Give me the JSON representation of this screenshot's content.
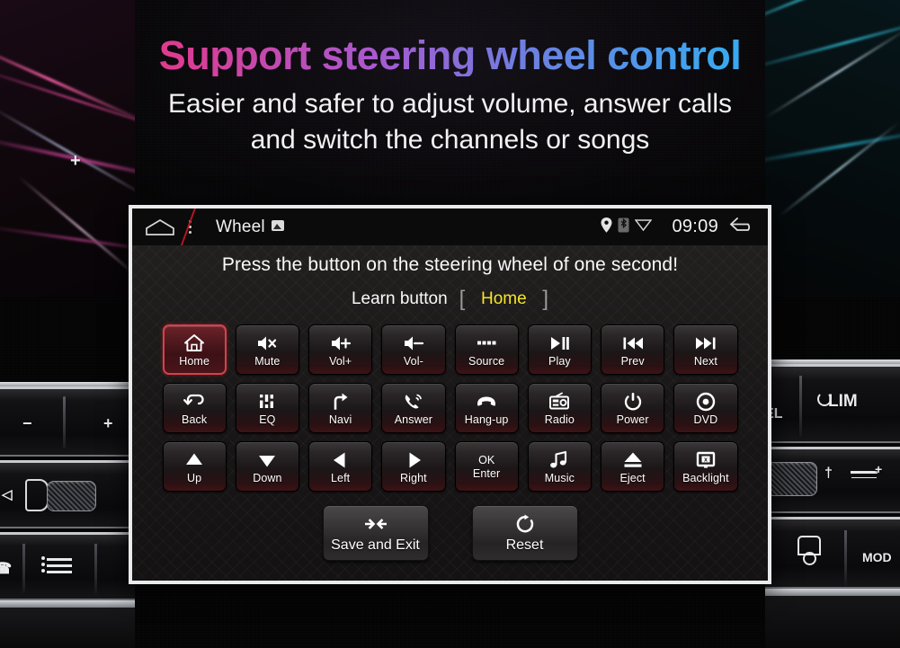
{
  "promo": {
    "headline": "Support steering wheel control",
    "subtitle_line1": "Easier and safer to adjust volume, answer calls",
    "subtitle_line2": "and switch the channels or songs",
    "headline_gradient_start": "#f9266f",
    "headline_gradient_end": "#24b6f5"
  },
  "device": {
    "statusbar": {
      "home_icon": "home-outline-icon",
      "menu_icon": "overflow-menu-icon",
      "title": "Wheel",
      "title_icon": "image-icon",
      "location_icon": "location-pin-icon",
      "bluetooth_icon": "bluetooth-icon",
      "wifi_icon": "wifi-icon",
      "time": "09:09",
      "back_icon": "back-arrow-icon"
    },
    "screen": {
      "prompt": "Press the button on the steering wheel of one second!",
      "learn_label": "Learn button",
      "bracket_left": "[",
      "bracket_right": "]",
      "learn_value": "Home",
      "learn_value_color": "#f6e52a",
      "selected_key": "Home",
      "selected_border_color": "#d8404a",
      "keys": [
        {
          "label": "Home",
          "icon": "home-icon",
          "selected": true
        },
        {
          "label": "Mute",
          "icon": "volume-mute-icon",
          "selected": false
        },
        {
          "label": "Vol+",
          "icon": "volume-up-icon",
          "selected": false
        },
        {
          "label": "Vol-",
          "icon": "volume-down-icon",
          "selected": false
        },
        {
          "label": "Source",
          "icon": "source-dots-icon",
          "selected": false
        },
        {
          "label": "Play",
          "icon": "play-pause-icon",
          "selected": false
        },
        {
          "label": "Prev",
          "icon": "previous-track-icon",
          "selected": false
        },
        {
          "label": "Next",
          "icon": "next-track-icon",
          "selected": false
        },
        {
          "label": "Back",
          "icon": "back-undo-icon",
          "selected": false
        },
        {
          "label": "EQ",
          "icon": "equalizer-icon",
          "selected": false
        },
        {
          "label": "Navi",
          "icon": "navigation-turn-icon",
          "selected": false
        },
        {
          "label": "Answer",
          "icon": "phone-answer-icon",
          "selected": false
        },
        {
          "label": "Hang-up",
          "icon": "phone-hangup-icon",
          "selected": false
        },
        {
          "label": "Radio",
          "icon": "radio-icon",
          "selected": false
        },
        {
          "label": "Power",
          "icon": "power-icon",
          "selected": false
        },
        {
          "label": "DVD",
          "icon": "disc-icon",
          "selected": false
        },
        {
          "label": "Up",
          "icon": "arrow-up-icon",
          "selected": false
        },
        {
          "label": "Down",
          "icon": "arrow-down-icon",
          "selected": false
        },
        {
          "label": "Left",
          "icon": "arrow-left-icon",
          "selected": false
        },
        {
          "label": "Right",
          "icon": "arrow-right-icon",
          "selected": false
        },
        {
          "label": "Enter",
          "icon": "ok-text-icon",
          "top_text": "OK",
          "selected": false
        },
        {
          "label": "Music",
          "icon": "music-note-icon",
          "selected": false
        },
        {
          "label": "Eject",
          "icon": "eject-icon",
          "selected": false
        },
        {
          "label": "Backlight",
          "icon": "backlight-off-icon",
          "selected": false
        }
      ],
      "actions": [
        {
          "label": "Save and Exit",
          "icon": "arrows-inward-icon"
        },
        {
          "label": "Reset",
          "icon": "refresh-circle-icon"
        }
      ]
    }
  }
}
